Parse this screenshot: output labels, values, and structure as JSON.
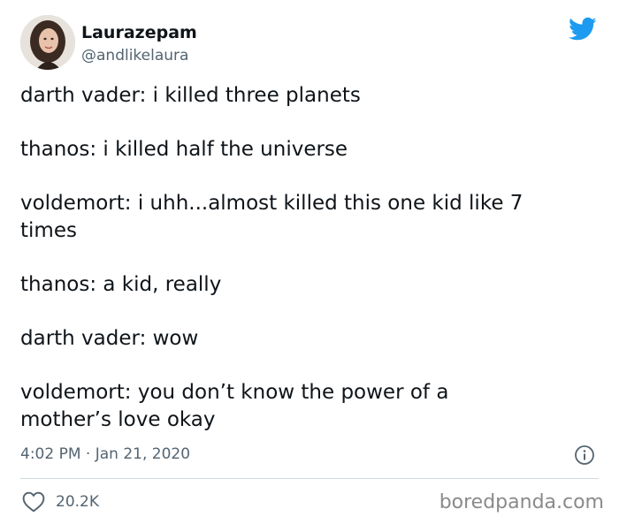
{
  "author": {
    "display_name": "Laurazepam",
    "handle": "@andlikelaura"
  },
  "tweet": {
    "lines": [
      "darth vader: i killed three planets",
      "thanos: i killed half the universe",
      "voldemort: i uhh...almost killed this one kid like 7\ntimes",
      "thanos: a kid, really",
      "darth vader: wow",
      "voldemort: you don’t know the power of a\nmother’s love okay"
    ],
    "timestamp": "4:02 PM · Jan 21, 2020"
  },
  "engagement": {
    "like_count": "20.2K"
  },
  "watermark": "boredpanda.com",
  "icons": {
    "brand": "twitter-bird-icon",
    "info": "info-icon",
    "like": "heart-icon"
  },
  "colors": {
    "twitter_blue": "#1d9bf0",
    "text_primary": "#0f1419",
    "text_secondary": "#536471",
    "divider": "#cfd9de"
  }
}
